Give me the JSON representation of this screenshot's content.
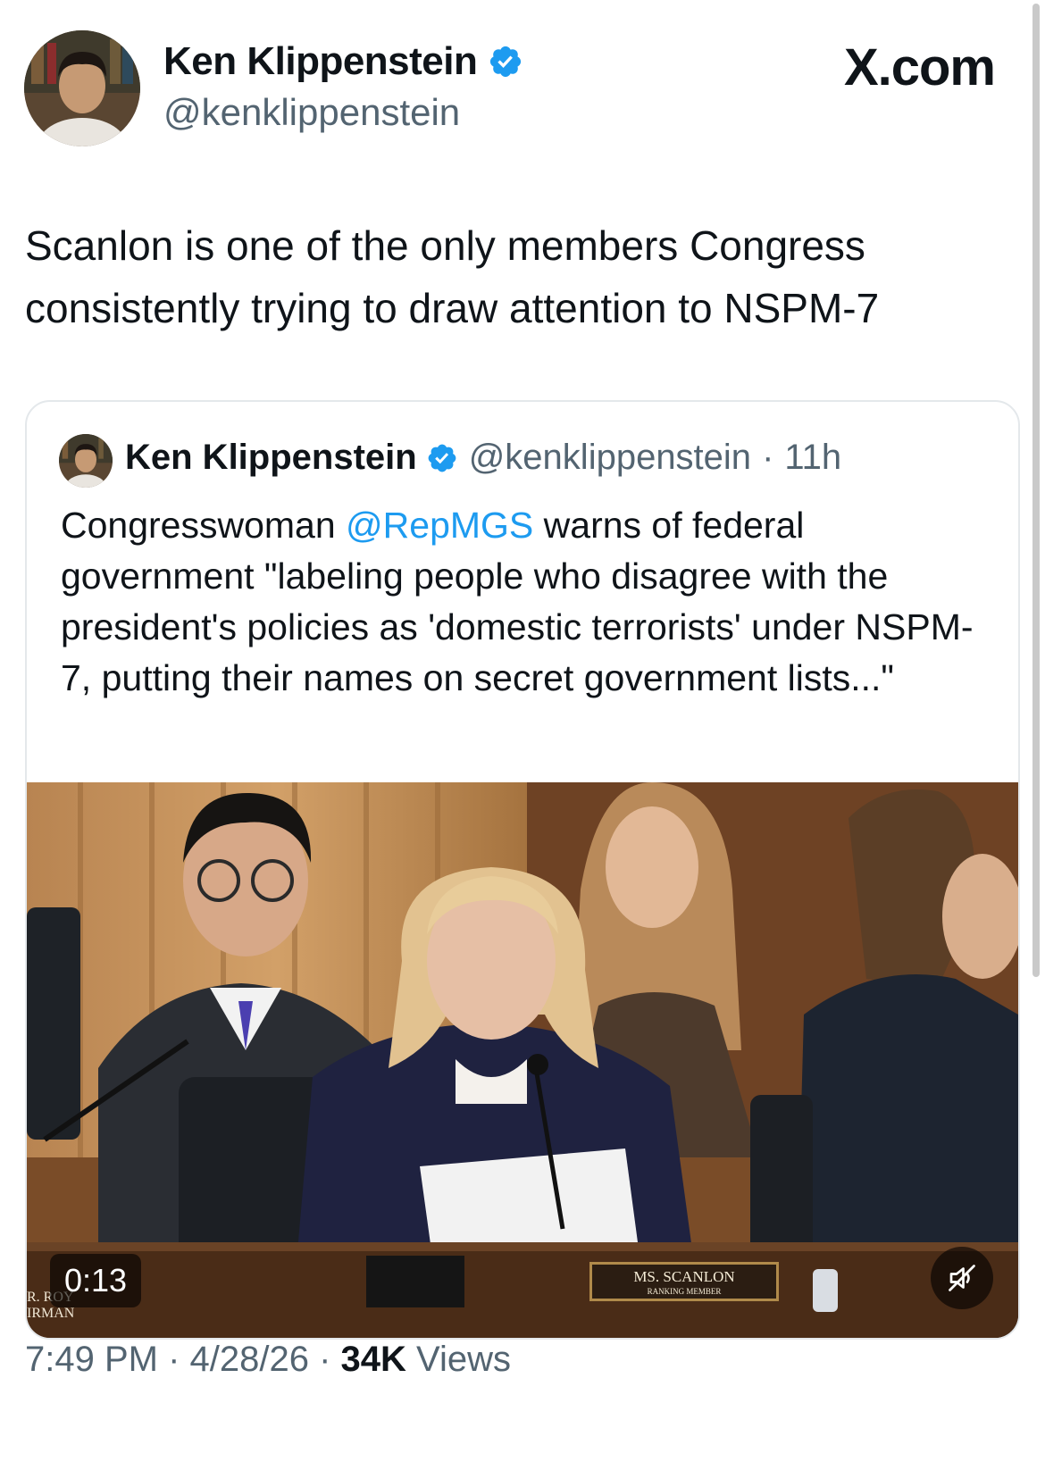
{
  "author": {
    "name": "Ken Klippenstein",
    "handle": "@kenklippenstein",
    "avatar_icon": "profile-photo"
  },
  "brand": "X.com",
  "tweet": {
    "text": "Scanlon is one of the only members Congress consistently trying to draw attention to NSPM-7"
  },
  "quoted": {
    "name": "Ken Klippenstein",
    "handle": "@kenklippenstein",
    "separator": "·",
    "age": "11h",
    "text_before": "Congresswoman ",
    "mention": "@RepMGS",
    "text_after": " warns of federal government \"labeling people who disagree with the president's policies as 'domestic terrorists' under NSPM-7, putting their names on secret government lists...\"",
    "video": {
      "duration": "0:13",
      "nameplate_line1": "MS. SCANLON",
      "nameplate_line2": "RANKING MEMBER",
      "left_plate_line1": "R. ROY",
      "left_plate_line2": "IRMAN",
      "mute_icon": "speaker-muted-icon"
    }
  },
  "footer": {
    "time": "7:49 PM",
    "sep1": " · ",
    "date": "4/28/26",
    "sep2": " · ",
    "views_count": "34K",
    "views_label": " Views"
  },
  "colors": {
    "verified": "#1d9bf0",
    "mention": "#1d9bf0",
    "secondary_text": "#536471"
  }
}
